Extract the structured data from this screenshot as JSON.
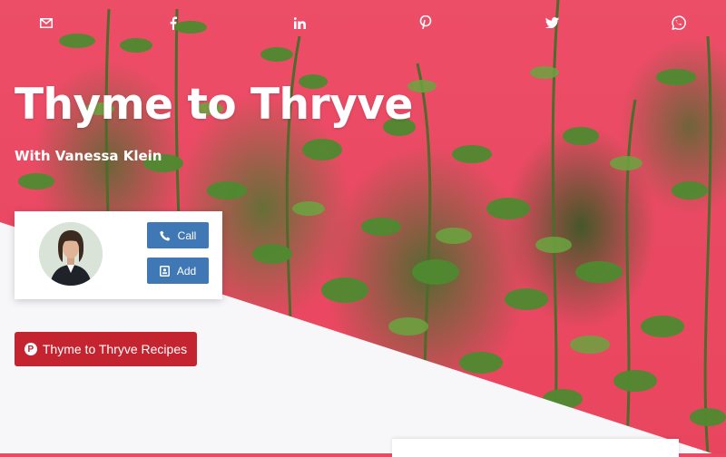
{
  "header": {
    "title": "Thyme to Thryve",
    "subtitle": "With Vanessa Klein"
  },
  "social_icons": [
    {
      "name": "email-icon"
    },
    {
      "name": "facebook-icon"
    },
    {
      "name": "linkedin-icon"
    },
    {
      "name": "pinterest-icon"
    },
    {
      "name": "twitter-icon"
    },
    {
      "name": "whatsapp-icon"
    }
  ],
  "contact_card": {
    "call_label": "Call",
    "add_label": "Add"
  },
  "recipes_button": {
    "label": "Thyme to Thryve Recipes"
  },
  "colors": {
    "hero_background": "#e94a63",
    "button_blue": "#3f78b4",
    "button_red": "#c4242f"
  }
}
